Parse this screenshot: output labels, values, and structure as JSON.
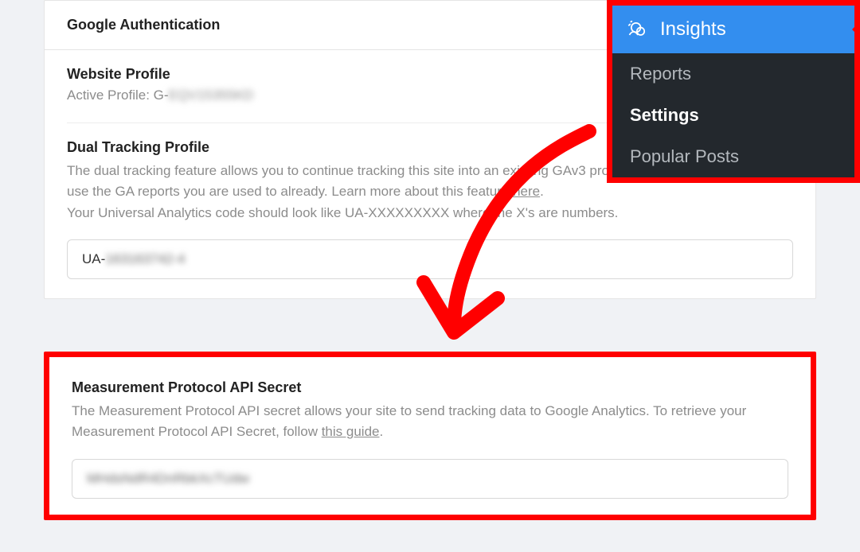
{
  "panel": {
    "header": "Google Authentication"
  },
  "website_profile": {
    "title": "Website Profile",
    "active_label": "Active Profile: ",
    "active_prefix": "G-",
    "active_blur": "EQV15355KD"
  },
  "dual_tracking": {
    "title": "Dual Tracking Profile",
    "desc1": "The dual tracking feature allows you to continue tracking this site into an existing GAv3 property so you can continue to use the GA reports you are used to already. Learn more about this feature ",
    "link1": "here",
    "period": ".",
    "desc2": "Your Universal Analytics code should look like UA-XXXXXXXXX where the X's are numbers.",
    "input_prefix": "UA-",
    "input_blur": "163163742-4"
  },
  "api_secret": {
    "title": "Measurement Protocol API Secret",
    "desc": "The Measurement Protocol API secret allows your site to send tracking data to Google Analytics. To retrieve your Measurement Protocol API Secret, follow ",
    "link": "this guide",
    "period": ".",
    "input_blur": "MHdsNdR4DnRbkXcTUdw"
  },
  "sidebar": {
    "brand": "Insights",
    "items": [
      "Reports",
      "Settings",
      "Popular Posts"
    ],
    "active_index": 1
  }
}
